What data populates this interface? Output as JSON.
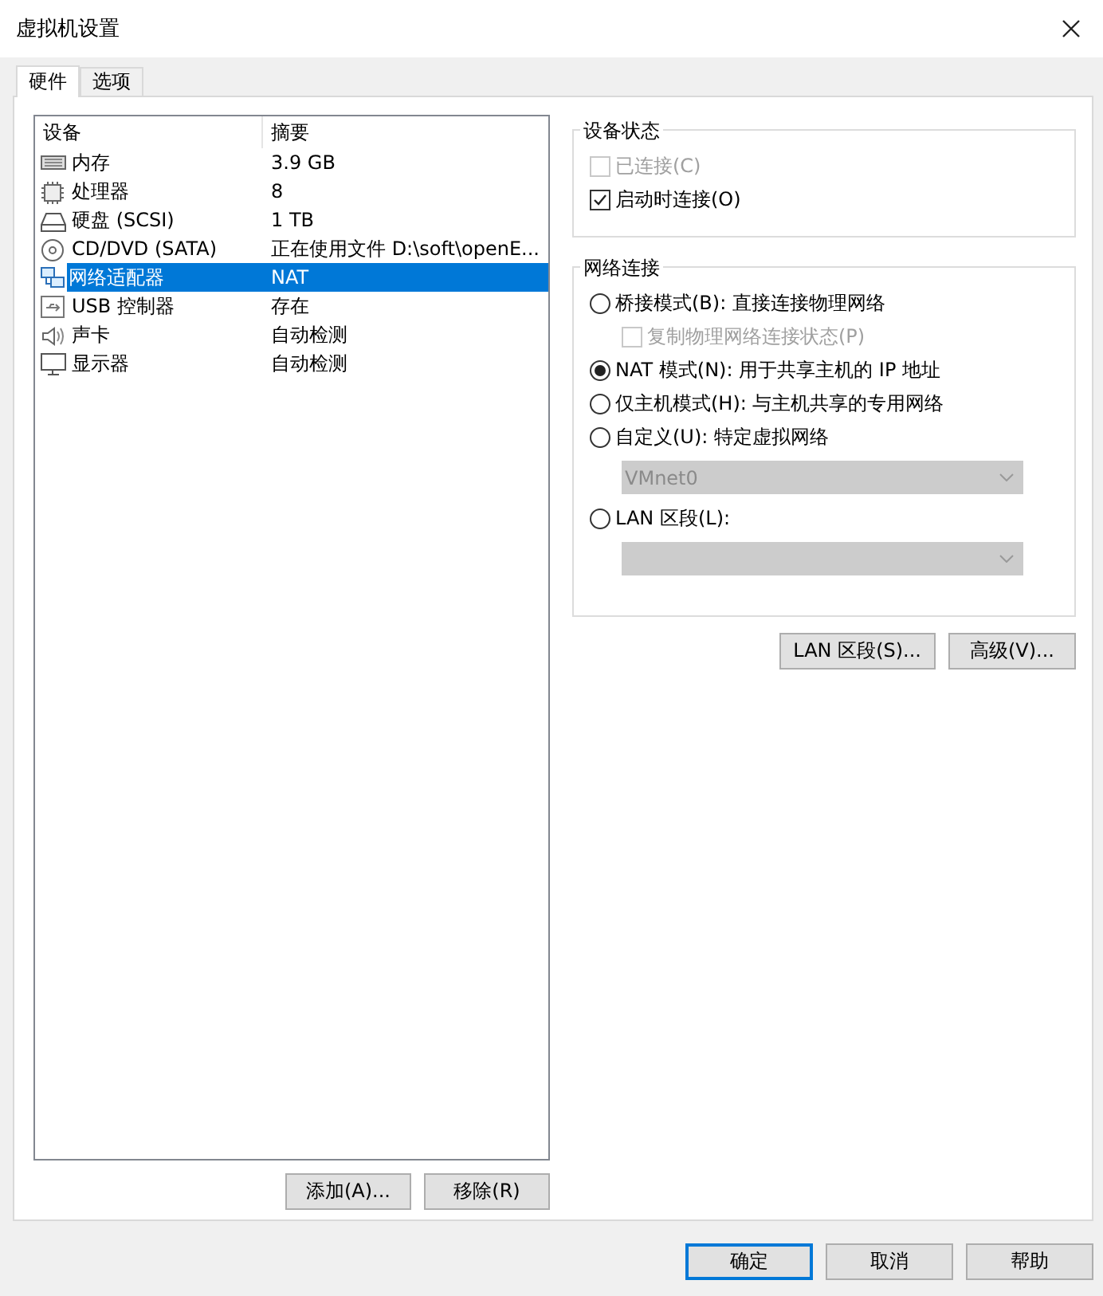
{
  "window": {
    "title": "虚拟机设置"
  },
  "tabs": [
    {
      "label": "硬件",
      "selected": true
    },
    {
      "label": "选项",
      "selected": false
    }
  ],
  "device_list": {
    "columns": [
      "设备",
      "摘要"
    ],
    "rows": [
      {
        "kind": "memory",
        "device": "内存",
        "summary": "3.9 GB",
        "selected": false
      },
      {
        "kind": "cpu",
        "device": "处理器",
        "summary": "8",
        "selected": false
      },
      {
        "kind": "disk",
        "device": "硬盘 (SCSI)",
        "summary": "1 TB",
        "selected": false
      },
      {
        "kind": "cd",
        "device": "CD/DVD (SATA)",
        "summary": "正在使用文件 D:\\soft\\openE...",
        "selected": false
      },
      {
        "kind": "network",
        "device": "网络适配器",
        "summary": "NAT",
        "selected": true
      },
      {
        "kind": "usb",
        "device": "USB 控制器",
        "summary": "存在",
        "selected": false
      },
      {
        "kind": "sound",
        "device": "声卡",
        "summary": "自动检测",
        "selected": false
      },
      {
        "kind": "display",
        "device": "显示器",
        "summary": "自动检测",
        "selected": false
      }
    ]
  },
  "list_buttons": [
    "添加(A)...",
    "移除(R)"
  ],
  "device_status": {
    "title": "设备状态",
    "options": [
      {
        "label": "已连接(C)",
        "checked": false,
        "disabled": true
      },
      {
        "label": "启动时连接(O)",
        "checked": true,
        "disabled": false
      }
    ]
  },
  "network_connection": {
    "title": "网络连接",
    "items": [
      {
        "kind": "radio",
        "label": "桥接模式(B): 直接连接物理网络",
        "selected": false
      },
      {
        "kind": "checkbox",
        "label": "复制物理网络连接状态(P)",
        "checked": false,
        "disabled": true
      },
      {
        "kind": "radio",
        "label": "NAT 模式(N): 用于共享主机的 IP 地址",
        "selected": true
      },
      {
        "kind": "radio",
        "label": "仅主机模式(H): 与主机共享的专用网络",
        "selected": false
      },
      {
        "kind": "radio",
        "label": "自定义(U): 特定虚拟网络",
        "selected": false
      },
      {
        "kind": "dropdown",
        "value": "VMnet0",
        "disabled": true
      },
      {
        "kind": "radio",
        "label": "LAN 区段(L):",
        "selected": false
      },
      {
        "kind": "dropdown",
        "disabled": true
      }
    ]
  },
  "network_buttons": [
    "LAN 区段(S)...",
    "高级(V)..."
  ],
  "dialog_buttons": [
    {
      "label": "确定",
      "default": true
    },
    {
      "label": "取消",
      "default": false
    },
    {
      "label": "帮助",
      "default": false
    }
  ]
}
